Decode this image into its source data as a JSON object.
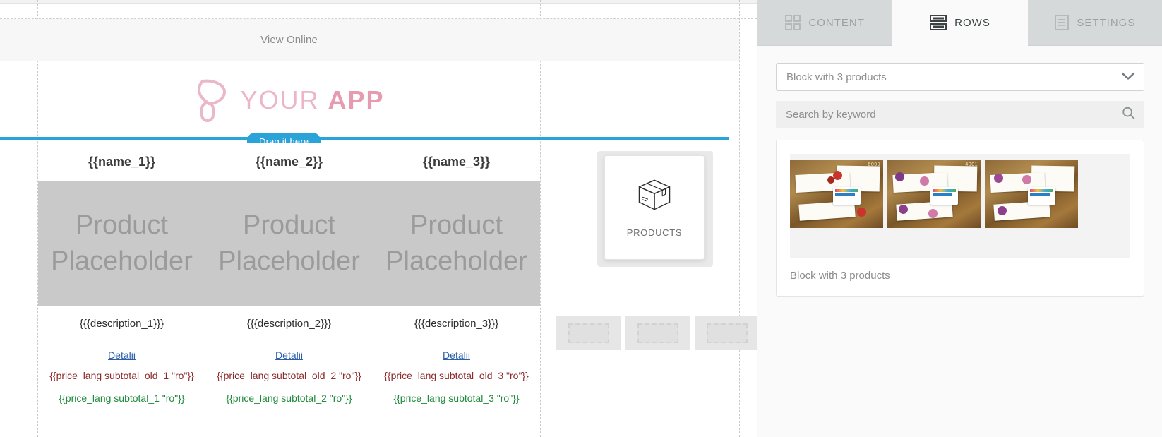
{
  "canvas": {
    "view_online": "View Online",
    "logo": {
      "text_light": "YOUR ",
      "text_bold": "APP",
      "mark": "balloon-logo-icon"
    },
    "drop_indicator": "Drag it here",
    "product_names": [
      "{{name_1}}",
      "{{name_2}}",
      "{{name_3}}"
    ],
    "placeholders": [
      "Product Placeholder",
      "Product Placeholder",
      "Product Placeholder"
    ],
    "descriptions": [
      "{{{description_1}}}",
      "{{{description_2}}}",
      "{{{description_3}}}"
    ],
    "detail_links": [
      "Detalii",
      "Detalii",
      "Detalii"
    ],
    "prices_old": [
      "{{price_lang subtotal_old_1 \"ro\"}}",
      "{{price_lang subtotal_old_2 \"ro\"}}",
      "{{price_lang subtotal_old_3 \"ro\"}}"
    ],
    "prices_new": [
      "{{price_lang subtotal_1 \"ro\"}}",
      "{{price_lang subtotal_2 \"ro\"}}",
      "{{price_lang subtotal_3 \"ro\"}}"
    ],
    "drag_card": {
      "label": "PRODUCTS",
      "icon": "package-box-icon"
    },
    "colors": {
      "drop_indicator": "#2aa3d8",
      "placeholder_bg": "#c9c9c9",
      "price_old": "#8b2b2b",
      "price_new": "#1f8a3b",
      "link": "#2b5fa8",
      "logo": "#edb6c6"
    }
  },
  "panel": {
    "tabs": [
      {
        "label": "CONTENT",
        "icon": "grid-squares-icon",
        "active": false
      },
      {
        "label": "ROWS",
        "icon": "rows-stack-icon",
        "active": true
      },
      {
        "label": "SETTINGS",
        "icon": "document-lines-icon",
        "active": false
      }
    ],
    "block_select": {
      "value": "Block with 3 products",
      "icon": "chevron-down-icon"
    },
    "search": {
      "placeholder": "Search by keyword",
      "value": "",
      "icon": "search-icon"
    },
    "result": {
      "caption": "Block with 3 products",
      "thumbnails": [
        {
          "alt": "wedding-invitation-photo-1",
          "badge": "6099"
        },
        {
          "alt": "wedding-invitation-photo-2",
          "badge": "4001"
        },
        {
          "alt": "wedding-invitation-photo-3",
          "badge": ""
        }
      ]
    }
  }
}
